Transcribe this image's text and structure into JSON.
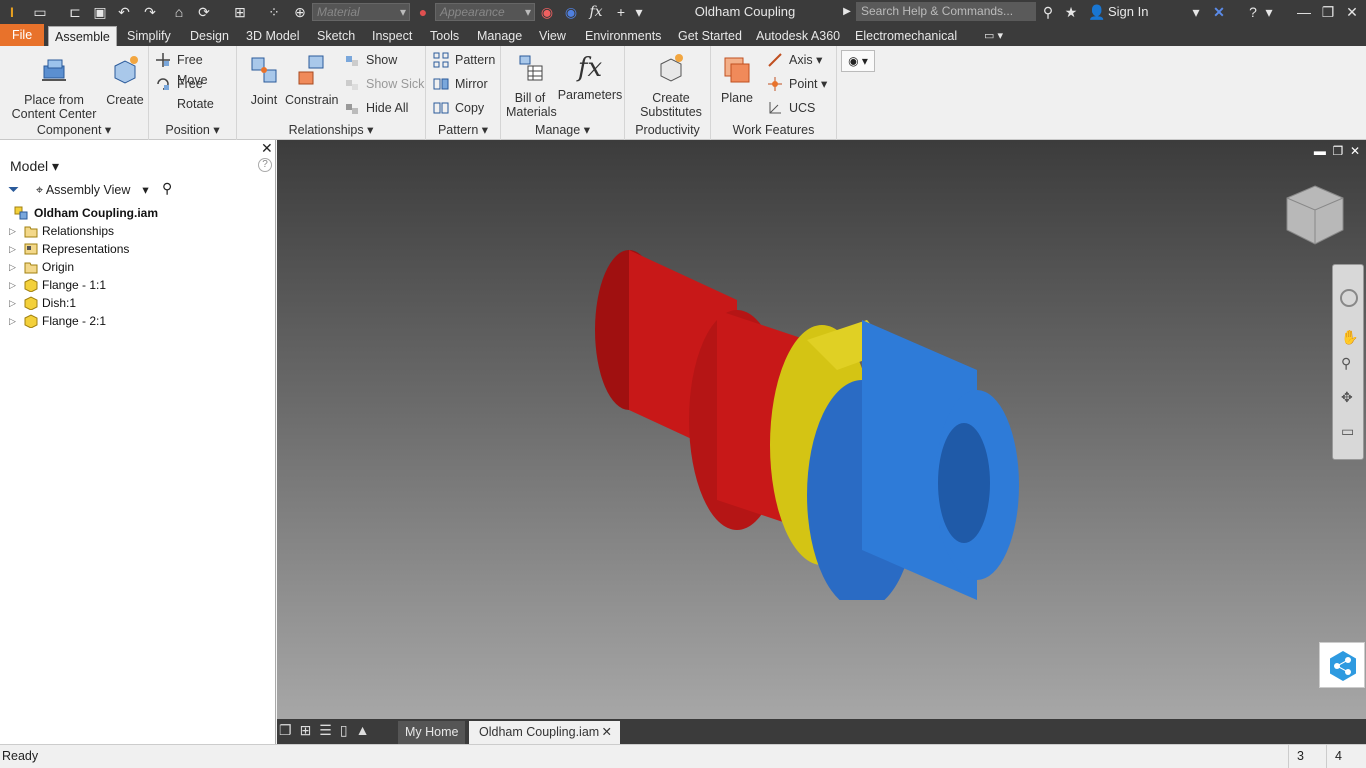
{
  "app": {
    "title": "Oldham Coupling"
  },
  "quick_access": {
    "material_placeholder": "Material",
    "appearance_placeholder": "Appearance",
    "search_placeholder": "Search Help & Commands...",
    "sign_in": "Sign In"
  },
  "menu": {
    "file": "File",
    "tabs": [
      "Assemble",
      "Simplify",
      "Design",
      "3D Model",
      "Sketch",
      "Inspect",
      "Tools",
      "Manage",
      "View",
      "Environments",
      "Get Started",
      "Autodesk A360",
      "Electromechanical"
    ]
  },
  "ribbon": {
    "component": {
      "label": "Component",
      "place_from_content_center": "Place from Content Center",
      "create": "Create"
    },
    "position": {
      "label": "Position",
      "free_move": "Free Move",
      "free_rotate": "Free Rotate"
    },
    "relationships": {
      "label": "Relationships",
      "joint": "Joint",
      "constrain": "Constrain",
      "show": "Show",
      "show_sick": "Show Sick",
      "hide_all": "Hide All"
    },
    "pattern": {
      "label": "Pattern",
      "pattern": "Pattern",
      "mirror": "Mirror",
      "copy": "Copy"
    },
    "manage": {
      "label": "Manage",
      "bill_of_materials": "Bill of Materials",
      "parameters": "Parameters"
    },
    "productivity": {
      "label": "Productivity",
      "create_substitutes": "Create Substitutes"
    },
    "work_features": {
      "label": "Work Features",
      "plane": "Plane",
      "axis": "Axis",
      "point": "Point",
      "ucs": "UCS"
    }
  },
  "browser": {
    "title": "Model",
    "view": "Assembly View",
    "root": "Oldham Coupling.iam",
    "nodes": [
      {
        "label": "Relationships",
        "icon": "folder-icon"
      },
      {
        "label": "Representations",
        "icon": "representations-icon"
      },
      {
        "label": "Origin",
        "icon": "folder-icon"
      },
      {
        "label": "Flange - 1:1",
        "icon": "part-icon"
      },
      {
        "label": "Dish:1",
        "icon": "part-icon"
      },
      {
        "label": "Flange - 2:1",
        "icon": "part-icon"
      }
    ]
  },
  "doctabs": {
    "home": "My Home",
    "active": "Oldham Coupling.iam"
  },
  "status": {
    "text": "Ready",
    "count1": "3",
    "count2": "4"
  },
  "colors": {
    "accent": "#e8722b",
    "flange1": "#c81818",
    "dish": "#d4c414",
    "flange2": "#2e7bd8"
  }
}
